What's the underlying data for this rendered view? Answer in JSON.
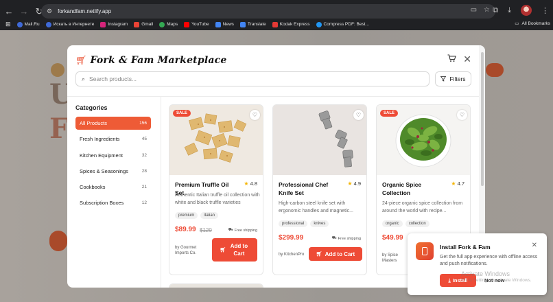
{
  "browser": {
    "url": "forkandfam.netlify.app",
    "bookmarks": [
      {
        "label": "Mail.Ru",
        "color": "#3f6ad8"
      },
      {
        "label": "Искать в Интернете",
        "color": "#3f6ad8"
      },
      {
        "label": "Instagram",
        "color": "#d6247a"
      },
      {
        "label": "Gmail",
        "color": "#ea4335"
      },
      {
        "label": "Maps",
        "color": "#34a853"
      },
      {
        "label": "YouTube",
        "color": "#ff0000"
      },
      {
        "label": "News",
        "color": "#4285f4"
      },
      {
        "label": "Translate",
        "color": "#4285f4"
      },
      {
        "label": "Kodak Express",
        "color": "#e53935"
      },
      {
        "label": "Compress PDF: Best...",
        "color": "#2196f3"
      }
    ],
    "all_bookmarks": "All Bookmarks"
  },
  "modal": {
    "title": "Fork & Fam Marketplace",
    "search_placeholder": "Search products...",
    "filters_label": "Filters",
    "categories_title": "Categories",
    "categories": [
      {
        "label": "All Products",
        "count": "156",
        "active": true
      },
      {
        "label": "Fresh Ingredients",
        "count": "45"
      },
      {
        "label": "Kitchen Equipment",
        "count": "32"
      },
      {
        "label": "Spices & Seasonings",
        "count": "28"
      },
      {
        "label": "Cookbooks",
        "count": "21"
      },
      {
        "label": "Subscription Boxes",
        "count": "12"
      }
    ],
    "products": [
      {
        "name": "Premium Truffle Oil Set",
        "rating": "4.8",
        "description": "Authentic Italian truffle oil collection with white and black truffle varieties",
        "tags": [
          "premium",
          "italian"
        ],
        "price": "$89.99",
        "old_price": "$120",
        "shipping": "Free shipping",
        "vendor": "by Gourmet Imports Co.",
        "button": "Add to Cart",
        "sale": "SALE"
      },
      {
        "name": "Professional Chef Knife Set",
        "rating": "4.9",
        "description": "High-carbon steel knife set with ergonomic handles and magnetic...",
        "tags": [
          "professional",
          "knives"
        ],
        "price": "$299.99",
        "shipping": "Free shipping",
        "vendor": "by KitchenPro",
        "button": "Add to Cart"
      },
      {
        "name": "Organic Spice Collection",
        "rating": "4.7",
        "description": "24-piece organic spice collection from around the world with recipe...",
        "tags": [
          "organic",
          "collection"
        ],
        "price": "$49.99",
        "vendor": "by Spice Masters",
        "sale": "SALE"
      }
    ]
  },
  "install": {
    "title": "Install Fork & Fam",
    "text": "Get the full app experience with offline access and push notifications.",
    "install_label": "Install",
    "not_now_label": "Not now"
  },
  "watermark": {
    "line1": "Activate Windows",
    "line2": "Go to Settings to activate Windows."
  }
}
